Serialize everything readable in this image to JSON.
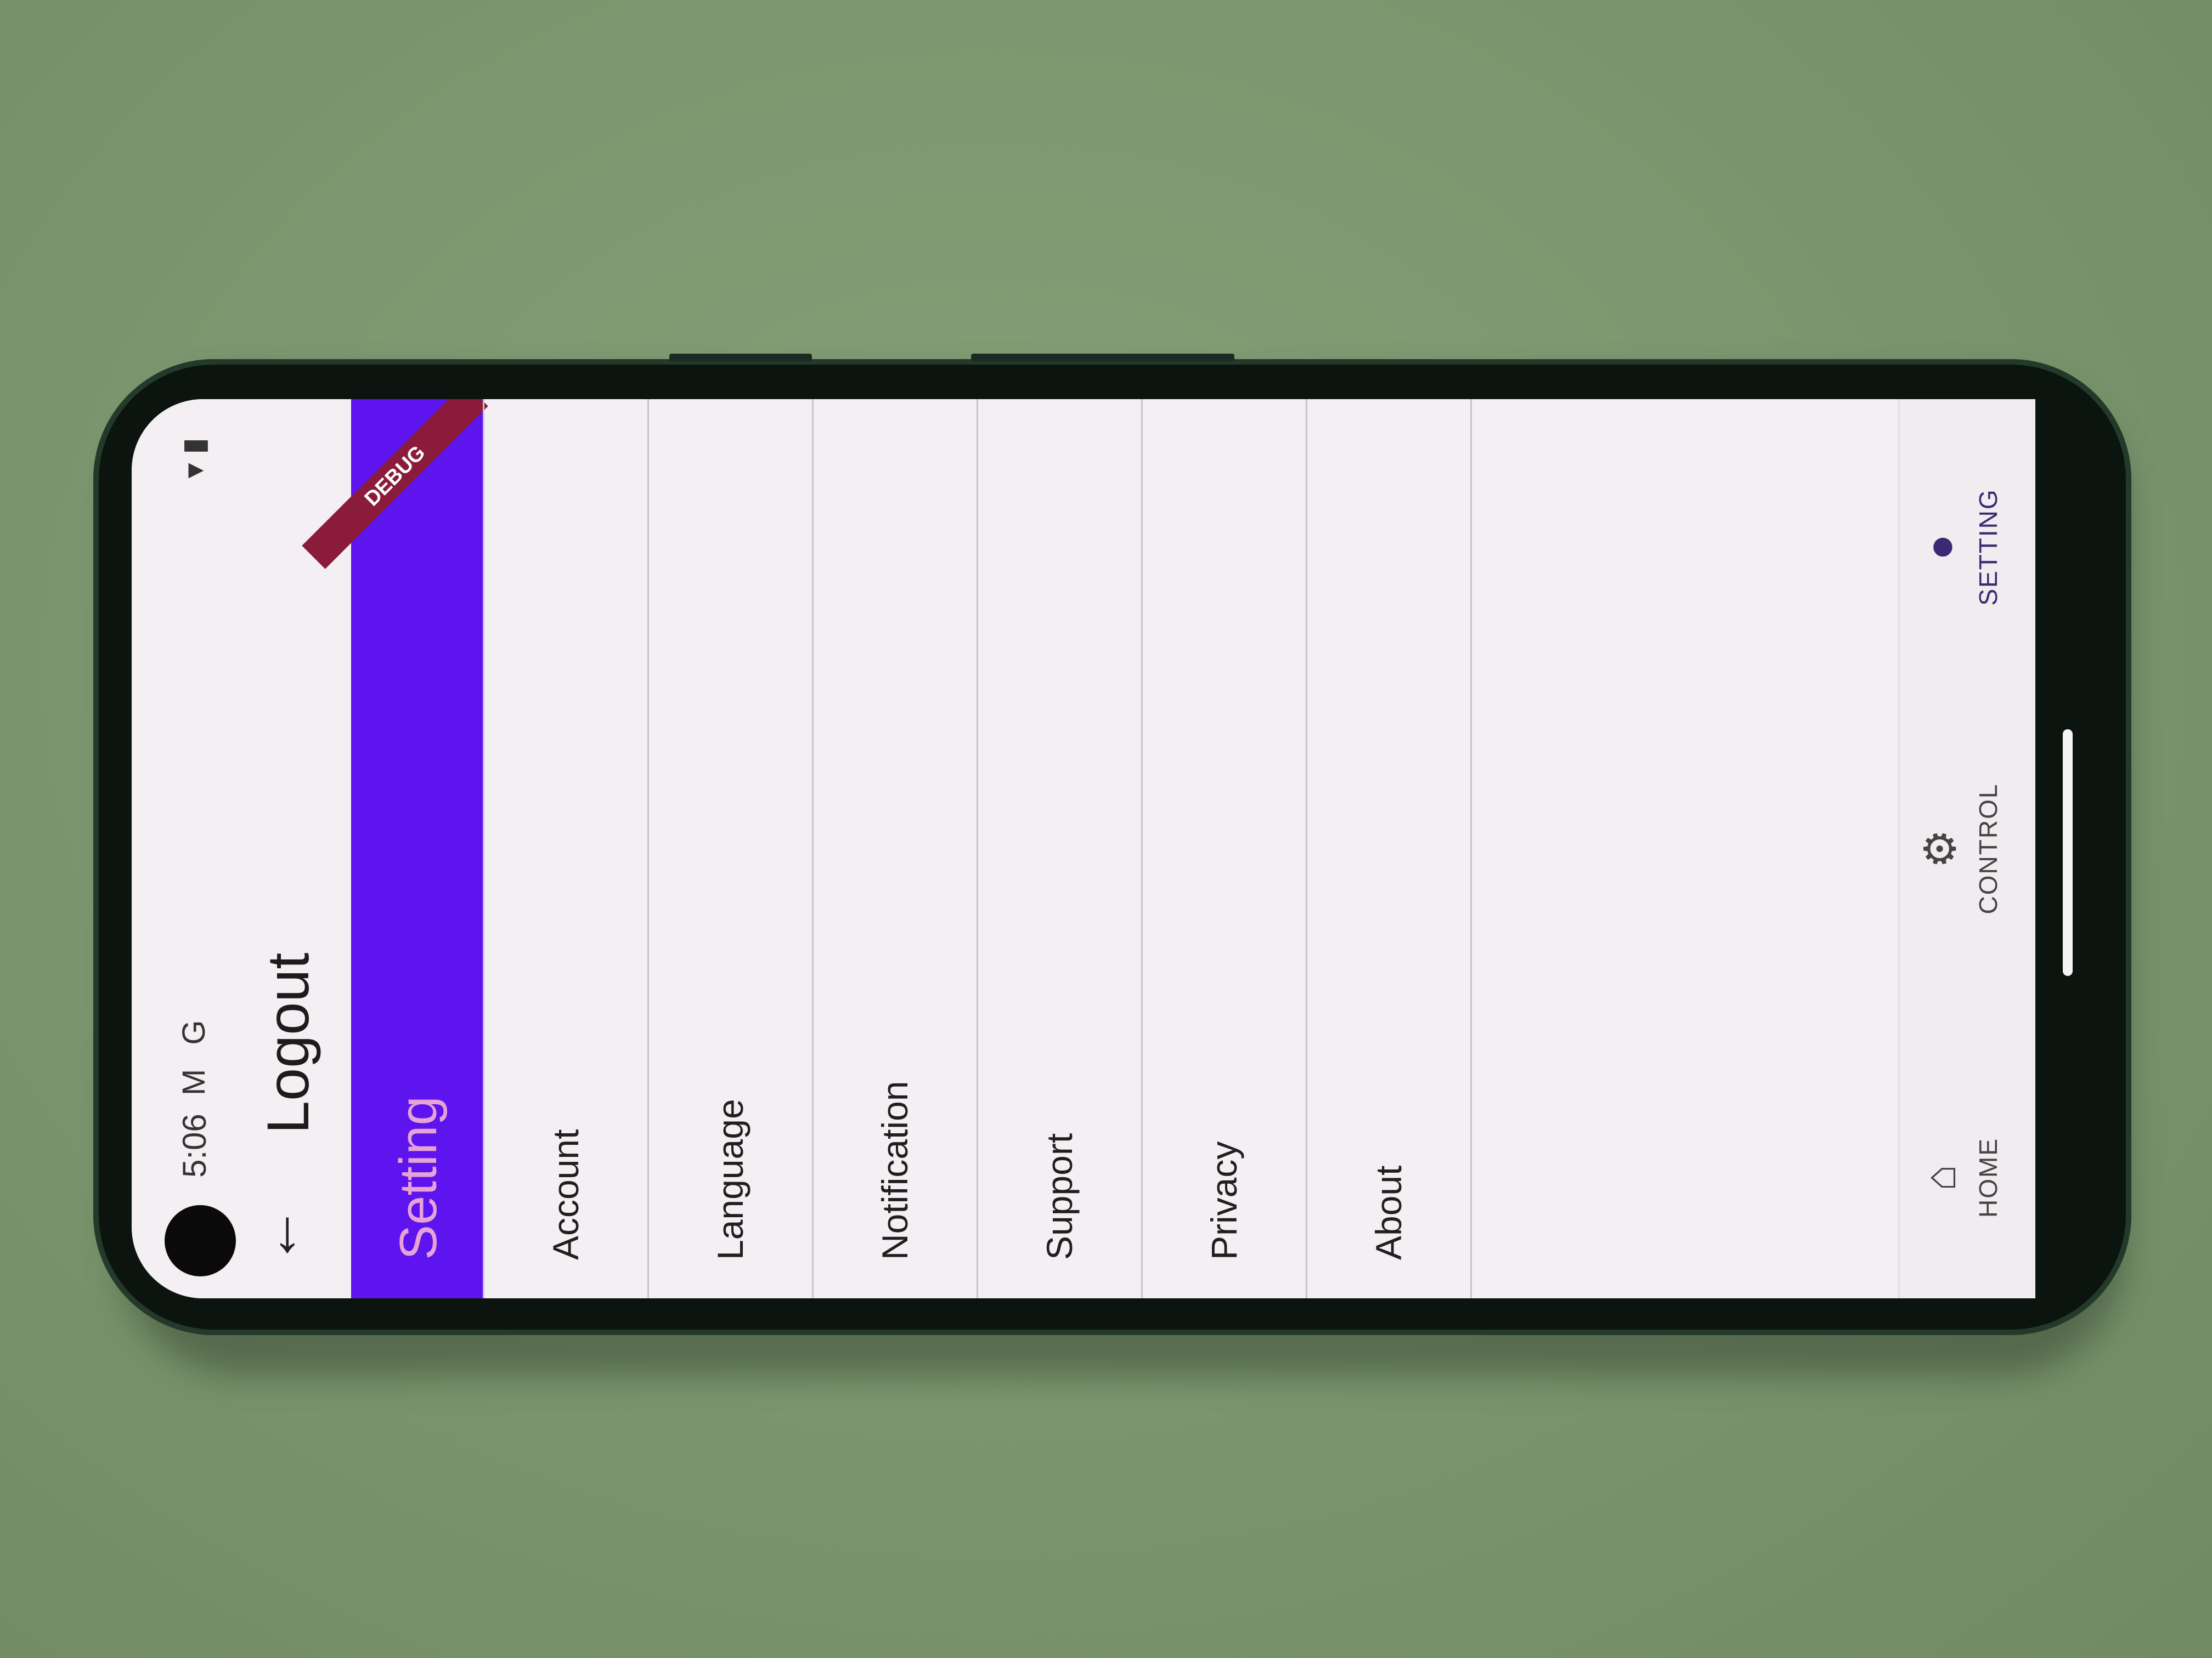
{
  "status_bar": {
    "time": "5:06",
    "icons": "M G",
    "right_icons": "▾ ▮"
  },
  "appbar": {
    "back_icon": "back-arrow-icon",
    "title": "Logout"
  },
  "header": {
    "title": "Setting",
    "debug_banner": "DEBUG",
    "color": "#5d14ee"
  },
  "menu": {
    "items": [
      {
        "label": "Account"
      },
      {
        "label": "Language"
      },
      {
        "label": "Notification"
      },
      {
        "label": "Support"
      },
      {
        "label": "Privacy"
      },
      {
        "label": "About"
      }
    ]
  },
  "bottom_nav": {
    "items": [
      {
        "label": "HOME",
        "icon": "home-icon",
        "glyph": "⌂"
      },
      {
        "label": "CONTROL",
        "icon": "gear-icon",
        "glyph": "⚙"
      },
      {
        "label": "SETTING",
        "icon": "person-icon",
        "glyph": "●"
      }
    ],
    "active": "SETTING"
  }
}
